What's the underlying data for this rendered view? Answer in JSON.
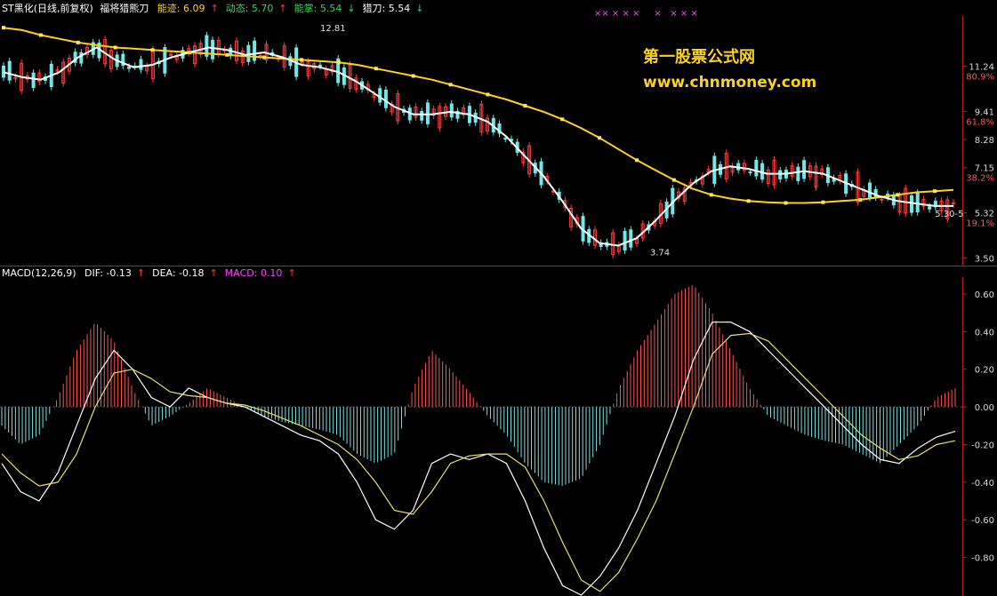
{
  "header": {
    "stock": "ST黑化(日线,前复权)",
    "indicator": "福将猎熊刀",
    "items": [
      {
        "label": "能迹:",
        "value": "6.09",
        "arrow": "↑",
        "color": "#ffd21a",
        "arrow_color": "#ff3b3b"
      },
      {
        "label": "动态:",
        "value": "5.70",
        "arrow": "↑",
        "color": "#39d353",
        "arrow_color": "#ff3b3b"
      },
      {
        "label": "能掌:",
        "value": "5.54",
        "arrow": "↓",
        "color": "#39d353",
        "arrow_color": "#39d353"
      },
      {
        "label": "猎刀:",
        "value": "5.54",
        "arrow": "↓",
        "color": "#ffffff",
        "arrow_color": "#39d353"
      }
    ]
  },
  "macd_header": {
    "name": "MACD(12,26,9)",
    "items": [
      {
        "label": "DIF:",
        "value": "-0.13",
        "arrow": "↑",
        "color": "#ffffff",
        "arrow_color": "#ff3b3b"
      },
      {
        "label": "DEA:",
        "value": "-0.18",
        "arrow": "↑",
        "color": "#ffffff",
        "arrow_color": "#ff3b3b"
      },
      {
        "label": "MACD:",
        "value": "0.10",
        "arrow": "↑",
        "color": "#ff44ff",
        "arrow_color": "#ff3b3b"
      }
    ]
  },
  "watermark": {
    "title": "第一股票公式网",
    "url": "www.chnmoney.com"
  },
  "marks_top": "×× × × ×     ×   × × ×",
  "chart_data": [
    {
      "type": "line",
      "panel": "price",
      "y_ticks": [
        {
          "value": 11.24,
          "label": "11.24",
          "pct": "80.9%"
        },
        {
          "value": 9.41,
          "label": "9.41",
          "pct": "61.8%"
        },
        {
          "value": 8.28,
          "label": "8.28"
        },
        {
          "value": 7.15,
          "label": "7.15",
          "pct": "38.2%"
        },
        {
          "value": 5.32,
          "label": "5.32",
          "pct": "19.1%"
        },
        {
          "value": 3.5,
          "label": "3.50"
        }
      ],
      "ylim": [
        3.3,
        13.2
      ],
      "annotations": [
        {
          "text": "12.81",
          "x": 120,
          "y": 12.81
        },
        {
          "text": "3.74",
          "x": 245,
          "y": 3.74
        },
        {
          "text": "5.30-5",
          "x": 353,
          "y": 5.3
        }
      ],
      "series": [
        {
          "color": "#ffd21a",
          "values": [
            12.8,
            12.7,
            12.5,
            12.35,
            12.2,
            12.1,
            12.0,
            11.95,
            11.9,
            11.85,
            11.8,
            11.75,
            11.7,
            11.65,
            11.6,
            11.55,
            11.5,
            11.45,
            11.4,
            11.3,
            11.15,
            11.0,
            10.85,
            10.7,
            10.5,
            10.3,
            10.1,
            9.9,
            9.65,
            9.4,
            9.1,
            8.75,
            8.35,
            7.9,
            7.45,
            7.05,
            6.65,
            6.3,
            6.05,
            5.9,
            5.8,
            5.75,
            5.72,
            5.72,
            5.75,
            5.8,
            5.85,
            5.95,
            6.05,
            6.15,
            6.2,
            6.25
          ]
        },
        {
          "color": "#ffffff",
          "values": [
            11.0,
            10.8,
            10.7,
            11.0,
            11.6,
            12.0,
            11.5,
            11.2,
            11.3,
            11.6,
            11.8,
            12.0,
            11.9,
            11.7,
            11.8,
            11.6,
            11.3,
            11.2,
            11.0,
            10.6,
            10.1,
            9.6,
            9.3,
            9.3,
            9.4,
            9.3,
            9.0,
            8.4,
            7.6,
            6.8,
            5.8,
            4.7,
            4.1,
            4.0,
            4.3,
            5.0,
            5.8,
            6.5,
            7.0,
            7.2,
            7.1,
            6.9,
            6.9,
            7.0,
            6.9,
            6.6,
            6.3,
            6.0,
            5.8,
            5.7,
            5.6,
            5.6
          ]
        }
      ]
    },
    {
      "type": "line",
      "panel": "macd",
      "y_ticks": [
        0.6,
        0.4,
        0.2,
        0.0,
        -0.2,
        -0.4,
        -0.6,
        -0.8
      ],
      "ylim": [
        -1.0,
        0.68
      ],
      "series": [
        {
          "name": "DIF",
          "color": "#ffffff",
          "values": [
            -0.3,
            -0.45,
            -0.5,
            -0.35,
            -0.1,
            0.15,
            0.3,
            0.2,
            0.05,
            0.0,
            0.1,
            0.05,
            0.02,
            0.0,
            -0.05,
            -0.1,
            -0.15,
            -0.18,
            -0.25,
            -0.4,
            -0.6,
            -0.65,
            -0.55,
            -0.3,
            -0.25,
            -0.28,
            -0.25,
            -0.3,
            -0.5,
            -0.75,
            -0.95,
            -1.0,
            -0.9,
            -0.75,
            -0.55,
            -0.3,
            -0.05,
            0.25,
            0.45,
            0.45,
            0.4,
            0.3,
            0.2,
            0.1,
            0.0,
            -0.1,
            -0.2,
            -0.28,
            -0.3,
            -0.22,
            -0.16,
            -0.13
          ]
        },
        {
          "name": "DEA",
          "color": "#e8e070",
          "values": [
            -0.25,
            -0.35,
            -0.42,
            -0.4,
            -0.25,
            0.0,
            0.18,
            0.2,
            0.15,
            0.08,
            0.06,
            0.05,
            0.02,
            0.01,
            -0.02,
            -0.06,
            -0.1,
            -0.15,
            -0.2,
            -0.28,
            -0.4,
            -0.55,
            -0.57,
            -0.45,
            -0.3,
            -0.26,
            -0.25,
            -0.25,
            -0.32,
            -0.5,
            -0.72,
            -0.92,
            -0.98,
            -0.88,
            -0.7,
            -0.5,
            -0.25,
            0.0,
            0.28,
            0.38,
            0.39,
            0.35,
            0.25,
            0.15,
            0.05,
            -0.05,
            -0.15,
            -0.22,
            -0.28,
            -0.26,
            -0.2,
            -0.18
          ]
        },
        {
          "name": "MACD",
          "color_pos": "#ff5555",
          "color_neg": "#7fe0e0",
          "values": [
            -0.1,
            -0.2,
            -0.15,
            0.05,
            0.3,
            0.45,
            0.35,
            0.1,
            -0.1,
            -0.05,
            0.02,
            0.1,
            0.05,
            0.0,
            -0.05,
            -0.08,
            -0.1,
            -0.12,
            -0.15,
            -0.25,
            -0.3,
            -0.25,
            0.1,
            0.3,
            0.2,
            0.08,
            -0.05,
            -0.15,
            -0.3,
            -0.4,
            -0.42,
            -0.38,
            -0.2,
            0.1,
            0.3,
            0.45,
            0.6,
            0.65,
            0.5,
            0.3,
            0.1,
            -0.05,
            -0.1,
            -0.15,
            -0.18,
            -0.2,
            -0.25,
            -0.3,
            -0.2,
            -0.1,
            0.05,
            0.1
          ]
        }
      ]
    }
  ]
}
